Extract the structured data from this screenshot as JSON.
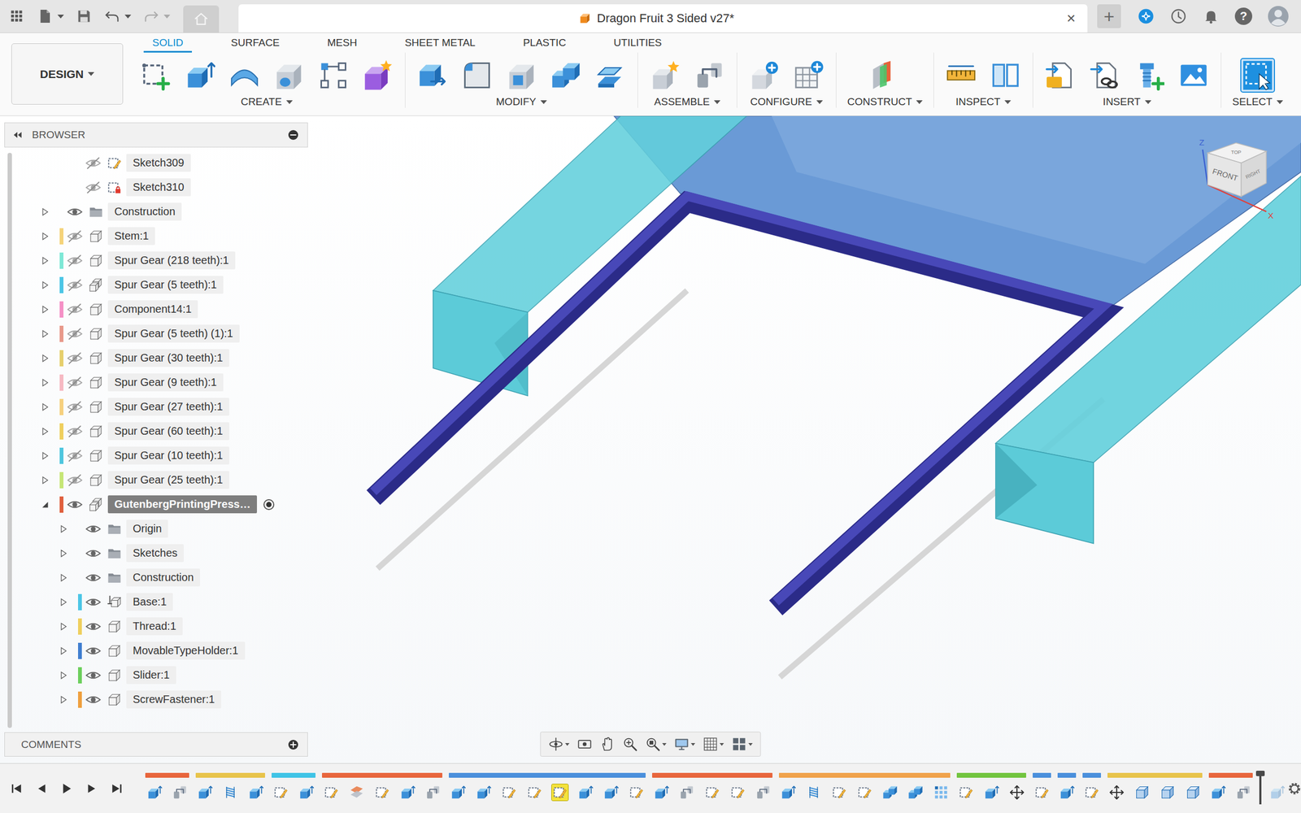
{
  "title_bar": {
    "title": "Dragon Fruit 3 Sided v27*",
    "close": "×",
    "new_tab": "+",
    "help": "?"
  },
  "quick_access": [
    {
      "kind": "file",
      "menu": true,
      "disabled": false
    },
    {
      "kind": "save",
      "menu": false,
      "disabled": false
    },
    {
      "kind": "undo",
      "menu": true,
      "disabled": false
    },
    {
      "kind": "redo",
      "menu": true,
      "disabled": true
    }
  ],
  "workspace": {
    "label": "DESIGN",
    "menu": true
  },
  "tabs": [
    {
      "label": "SOLID",
      "selected": true
    },
    {
      "label": "SURFACE",
      "selected": false
    },
    {
      "label": "MESH",
      "selected": false
    },
    {
      "label": "SHEET METAL",
      "selected": false
    },
    {
      "label": "PLASTIC",
      "selected": false
    },
    {
      "label": "UTILITIES",
      "selected": false
    }
  ],
  "tool_groups": [
    {
      "label": "CREATE",
      "menu": true,
      "tools": [
        {
          "kind": "new-sketch",
          "active": false
        },
        {
          "kind": "extrude",
          "active": false
        },
        {
          "kind": "revolve",
          "active": false
        },
        {
          "kind": "hole",
          "active": false
        },
        {
          "kind": "rect-pattern",
          "active": false
        },
        {
          "kind": "new-body",
          "active": false
        }
      ]
    },
    {
      "label": "MODIFY",
      "menu": true,
      "tools": [
        {
          "kind": "press-pull",
          "active": false
        },
        {
          "kind": "fillet",
          "active": false
        },
        {
          "kind": "shell",
          "active": false
        },
        {
          "kind": "combine",
          "active": false
        },
        {
          "kind": "offset-face",
          "active": false
        }
      ]
    },
    {
      "label": "ASSEMBLE",
      "menu": true,
      "tools": [
        {
          "kind": "new-component",
          "active": false
        },
        {
          "kind": "joint",
          "active": false
        }
      ]
    },
    {
      "label": "CONFIGURE",
      "menu": true,
      "tools": [
        {
          "kind": "configure-add",
          "active": false
        },
        {
          "kind": "configure-table",
          "active": false
        }
      ]
    },
    {
      "label": "CONSTRUCT",
      "menu": true,
      "tools": [
        {
          "kind": "offset-plane",
          "active": false
        }
      ]
    },
    {
      "label": "INSPECT",
      "menu": true,
      "tools": [
        {
          "kind": "measure",
          "active": false
        },
        {
          "kind": "section",
          "active": false
        }
      ]
    },
    {
      "label": "INSERT",
      "menu": true,
      "tools": [
        {
          "kind": "insert-svg",
          "active": false
        },
        {
          "kind": "insert-derive",
          "active": false
        },
        {
          "kind": "insert-mcmaster",
          "active": false
        },
        {
          "kind": "insert-canvas",
          "active": false
        }
      ]
    },
    {
      "label": "SELECT",
      "menu": true,
      "tools": [
        {
          "kind": "select",
          "active": true
        }
      ]
    }
  ],
  "browser": {
    "title": "BROWSER",
    "items": [
      {
        "name": "Sketch309",
        "level": 1,
        "toggle": "none",
        "visible": false,
        "kind": "sketch",
        "selected": false
      },
      {
        "name": "Sketch310",
        "level": 1,
        "toggle": "none",
        "visible": false,
        "kind": "sketch-locked",
        "selected": false
      },
      {
        "name": "Construction",
        "level": 0,
        "toggle": "collapsed",
        "visible": true,
        "kind": "folder",
        "selected": false
      },
      {
        "name": "Stem:1",
        "level": 0,
        "toggle": "collapsed",
        "visible": false,
        "kind": "component",
        "selected": false,
        "color": "#f5d37a"
      },
      {
        "name": "Spur Gear (218 teeth):1",
        "level": 0,
        "toggle": "collapsed",
        "visible": false,
        "kind": "component",
        "selected": false,
        "color": "#7ee8d6"
      },
      {
        "name": "Spur Gear (5 teeth):1",
        "level": 0,
        "toggle": "collapsed",
        "visible": false,
        "kind": "component-multi",
        "selected": false,
        "color": "#4cc6e6"
      },
      {
        "name": "Component14:1",
        "level": 0,
        "toggle": "collapsed",
        "visible": false,
        "kind": "component",
        "selected": false,
        "color": "#f590c6"
      },
      {
        "name": "Spur Gear (5 teeth) (1):1",
        "level": 0,
        "toggle": "collapsed",
        "visible": false,
        "kind": "component",
        "selected": false,
        "color": "#e8998a"
      },
      {
        "name": "Spur Gear (30 teeth):1",
        "level": 0,
        "toggle": "collapsed",
        "visible": false,
        "kind": "component",
        "selected": false,
        "color": "#e6cf6c"
      },
      {
        "name": "Spur Gear (9 teeth):1",
        "level": 0,
        "toggle": "collapsed",
        "visible": false,
        "kind": "component",
        "selected": false,
        "color": "#f6b9c2"
      },
      {
        "name": "Spur Gear (27 teeth):1",
        "level": 0,
        "toggle": "collapsed",
        "visible": false,
        "kind": "component",
        "selected": false,
        "color": "#f6d07e"
      },
      {
        "name": "Spur Gear (60 teeth):1",
        "level": 0,
        "toggle": "collapsed",
        "visible": false,
        "kind": "component",
        "selected": false,
        "color": "#efcf5e"
      },
      {
        "name": "Spur Gear (10 teeth):1",
        "level": 0,
        "toggle": "collapsed",
        "visible": false,
        "kind": "component",
        "selected": false,
        "color": "#4ec6de"
      },
      {
        "name": "Spur Gear (25 teeth):1",
        "level": 0,
        "toggle": "collapsed",
        "visible": false,
        "kind": "component",
        "selected": false,
        "color": "#c6e676"
      },
      {
        "name": "GutenbergPrintingPress…",
        "level": 0,
        "toggle": "expanded",
        "visible": true,
        "kind": "component-multi",
        "selected": true,
        "color": "#e0603e",
        "activated": true
      },
      {
        "name": "Origin",
        "level": 1,
        "toggle": "collapsed",
        "visible": true,
        "kind": "folder",
        "selected": false
      },
      {
        "name": "Sketches",
        "level": 1,
        "toggle": "collapsed",
        "visible": true,
        "kind": "folder",
        "selected": false
      },
      {
        "name": "Construction",
        "level": 1,
        "toggle": "collapsed",
        "visible": true,
        "kind": "folder",
        "selected": false
      },
      {
        "name": "Base:1",
        "level": 1,
        "toggle": "collapsed",
        "visible": true,
        "kind": "component-grounded",
        "selected": false,
        "color": "#4cc6e6"
      },
      {
        "name": "Thread:1",
        "level": 1,
        "toggle": "collapsed",
        "visible": true,
        "kind": "component",
        "selected": false,
        "color": "#efcf5e"
      },
      {
        "name": "MovableTypeHolder:1",
        "level": 1,
        "toggle": "collapsed",
        "visible": true,
        "kind": "component",
        "selected": false,
        "color": "#3f7ed0"
      },
      {
        "name": "Slider:1",
        "level": 1,
        "toggle": "collapsed",
        "visible": true,
        "kind": "component",
        "selected": false,
        "color": "#6ccf5c"
      },
      {
        "name": "ScrewFastener:1",
        "level": 1,
        "toggle": "collapsed",
        "visible": true,
        "kind": "component",
        "selected": false,
        "color": "#ef9f3e"
      }
    ]
  },
  "comments": {
    "title": "COMMENTS"
  },
  "viewcube": {
    "front": "FRONT",
    "top": "TOP",
    "right": "RIGHT",
    "z": "Z",
    "x": "X"
  },
  "nav_tools": [
    {
      "kind": "orbit",
      "menu": true
    },
    {
      "kind": "look",
      "menu": false
    },
    {
      "kind": "pan",
      "menu": false
    },
    {
      "kind": "zoom",
      "menu": false
    },
    {
      "kind": "fit",
      "menu": true
    },
    {
      "kind": "display",
      "menu": true
    },
    {
      "kind": "grid",
      "menu": true
    },
    {
      "kind": "viewports",
      "menu": true
    }
  ],
  "timeline": {
    "groups": [
      {
        "color": "#e8653c",
        "items": [
          {
            "kind": "extrude",
            "selected": false
          },
          {
            "kind": "joint",
            "selected": false
          }
        ]
      },
      {
        "color": "#e8c34a",
        "items": [
          {
            "kind": "extrude",
            "selected": false
          },
          {
            "kind": "thread",
            "selected": false
          },
          {
            "kind": "extrude",
            "selected": false
          }
        ]
      },
      {
        "color": "#3fc3e6",
        "items": [
          {
            "kind": "sketch",
            "selected": false
          },
          {
            "kind": "extrude",
            "selected": false
          }
        ]
      },
      {
        "color": "#e8653c",
        "items": [
          {
            "kind": "sketch",
            "selected": false
          },
          {
            "kind": "plane",
            "selected": false
          },
          {
            "kind": "sketch",
            "selected": false
          },
          {
            "kind": "extrude",
            "selected": false
          },
          {
            "kind": "joint",
            "selected": false
          }
        ]
      },
      {
        "color": "#4a8fdc",
        "items": [
          {
            "kind": "extrude",
            "selected": false
          },
          {
            "kind": "extrude",
            "selected": false
          },
          {
            "kind": "sketch",
            "selected": false
          },
          {
            "kind": "sketch",
            "selected": false
          },
          {
            "kind": "sketch",
            "selected": true
          },
          {
            "kind": "extrude",
            "selected": false
          },
          {
            "kind": "extrude",
            "selected": false
          },
          {
            "kind": "sketch",
            "selected": false
          }
        ]
      },
      {
        "color": "#e8653c",
        "items": [
          {
            "kind": "extrude",
            "selected": false
          },
          {
            "kind": "joint",
            "selected": false
          },
          {
            "kind": "sketch",
            "selected": false
          },
          {
            "kind": "sketch",
            "selected": false
          },
          {
            "kind": "joint",
            "selected": false
          }
        ]
      },
      {
        "color": "#f0a24a",
        "items": [
          {
            "kind": "extrude",
            "selected": false
          },
          {
            "kind": "thread",
            "selected": false
          },
          {
            "kind": "sketch",
            "selected": false
          },
          {
            "kind": "sketch",
            "selected": false
          },
          {
            "kind": "combine",
            "selected": false
          },
          {
            "kind": "combine",
            "selected": false
          },
          {
            "kind": "pattern",
            "selected": false
          }
        ]
      },
      {
        "color": "#72c43e",
        "items": [
          {
            "kind": "sketch",
            "selected": false
          },
          {
            "kind": "extrude",
            "selected": false
          },
          {
            "kind": "move",
            "selected": false
          }
        ]
      },
      {
        "color": "#4a8fdc",
        "items": [
          {
            "kind": "sketch",
            "selected": false
          }
        ]
      },
      {
        "color": "#4a8fdc",
        "items": [
          {
            "kind": "extrude",
            "selected": false
          }
        ]
      },
      {
        "color": "#4a8fdc",
        "items": [
          {
            "kind": "sketch",
            "selected": false
          }
        ]
      },
      {
        "color": "#e8c34a",
        "items": [
          {
            "kind": "move",
            "selected": false
          },
          {
            "kind": "box",
            "selected": false
          },
          {
            "kind": "box",
            "selected": false
          },
          {
            "kind": "box",
            "selected": false
          }
        ]
      },
      {
        "color": "#e8653c",
        "items": [
          {
            "kind": "extrude",
            "selected": false
          },
          {
            "kind": "joint",
            "selected": false
          }
        ]
      }
    ],
    "rolled_back": [
      {
        "kind": "extrude",
        "selected": false
      }
    ]
  }
}
